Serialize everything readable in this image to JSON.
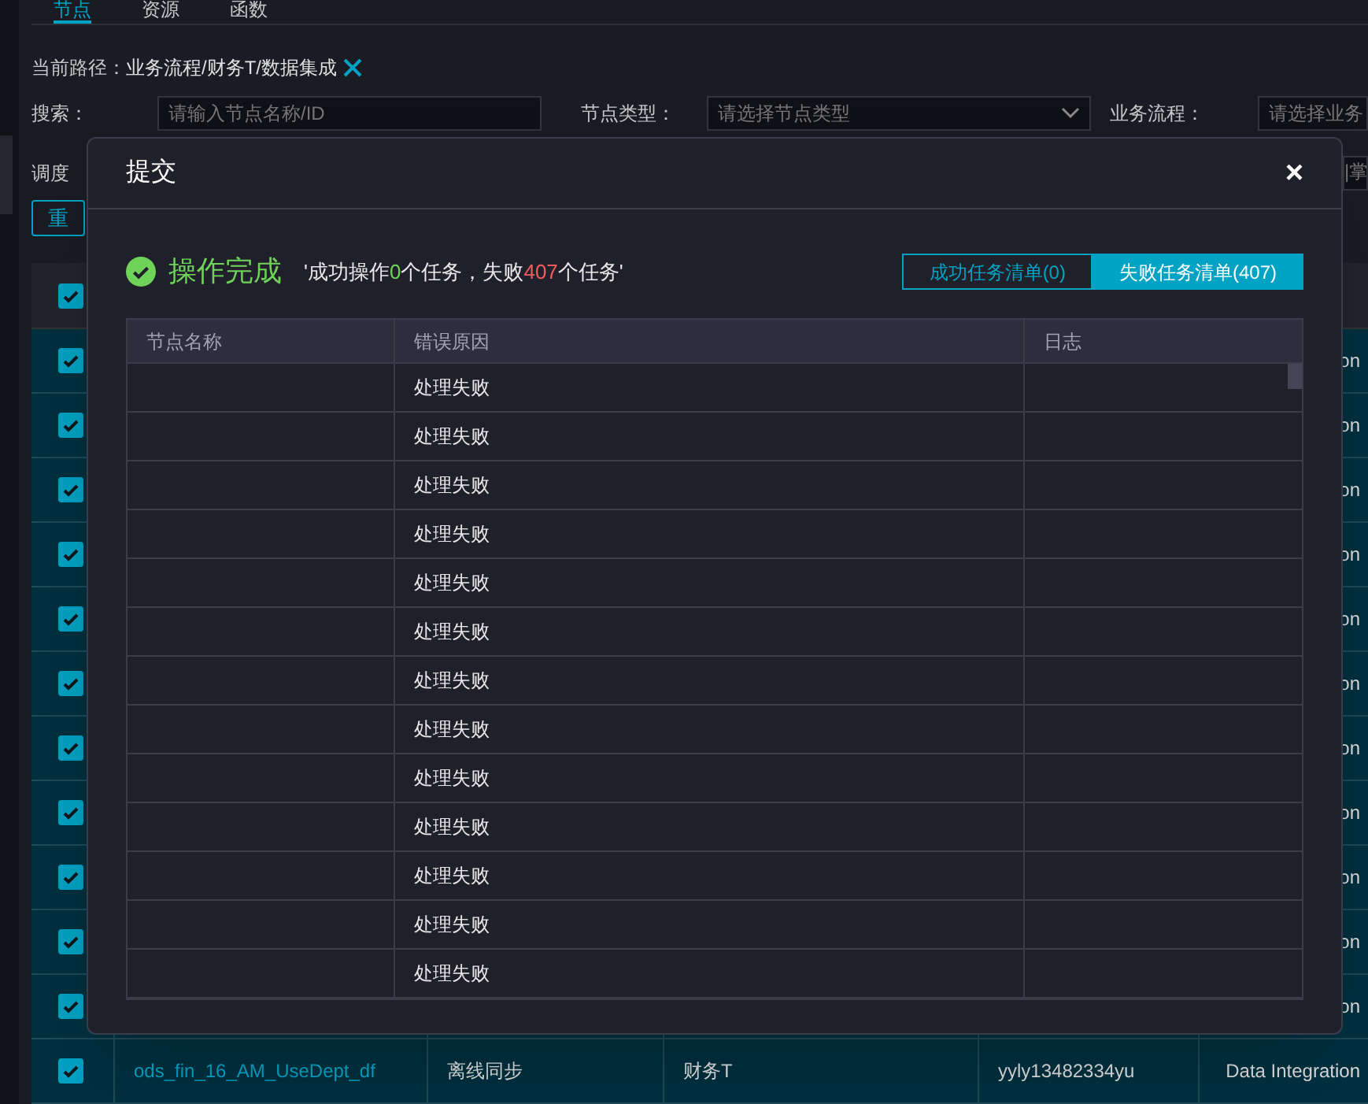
{
  "tabs": [
    {
      "label": "节点",
      "selected": true
    },
    {
      "label": "资源",
      "selected": false
    },
    {
      "label": "函数",
      "selected": false
    }
  ],
  "path": {
    "label": "当前路径：",
    "value": "业务流程/财务T/数据集成"
  },
  "filters": [
    {
      "label": "搜索：",
      "placeholder": "请输入节点名称/ID",
      "kind": "input"
    },
    {
      "label": "节点类型：",
      "placeholder": "请选择节点类型",
      "kind": "select"
    },
    {
      "label": "业务流程：",
      "placeholder": "请选择业务",
      "kind": "input"
    }
  ],
  "filters_row2": {
    "label": "调度",
    "field_text": "|掌"
  },
  "reset_button": "重",
  "table": {
    "header_checked": true,
    "rows": [
      {
        "checked": true,
        "column_6": "on"
      },
      {
        "checked": true,
        "column_6": "on"
      },
      {
        "checked": true,
        "column_6": "on"
      },
      {
        "checked": true,
        "column_6": "on"
      },
      {
        "checked": true,
        "column_6": "on"
      },
      {
        "checked": true,
        "column_6": "on"
      },
      {
        "checked": true,
        "column_6": "on"
      },
      {
        "checked": true,
        "column_6": "on"
      },
      {
        "checked": true,
        "column_6": "on"
      },
      {
        "checked": true,
        "column_6": "on"
      },
      {
        "checked": true,
        "column_6": "on"
      },
      {
        "checked": true,
        "name": "ods_fin_16_AM_UseDept_df",
        "type": "离线同步",
        "flow": "财务T",
        "owner": "yyly13482334yu",
        "column_6": "Data Integration"
      }
    ]
  },
  "dialog": {
    "title": "提交",
    "close": "×",
    "status": "操作完成",
    "message": [
      {
        "text": "'成功操作",
        "color": "#e8e8e8"
      },
      {
        "text": "0",
        "color": "#6fd35a"
      },
      {
        "text": "个任务，失败",
        "color": "#e8e8e8"
      },
      {
        "text": "407",
        "color": "#f35d5d"
      },
      {
        "text": "个任务'",
        "color": "#e8e8e8"
      }
    ],
    "lists": [
      {
        "label": "成功任务清单(0)",
        "selected": false
      },
      {
        "label": "失败任务清单(407)",
        "selected": true
      }
    ],
    "columns": [
      "节点名称",
      "错误原因",
      "日志"
    ],
    "rows": [
      {
        "error_reason": "处理失败"
      },
      {
        "error_reason": "处理失败"
      },
      {
        "error_reason": "处理失败"
      },
      {
        "error_reason": "处理失败"
      },
      {
        "error_reason": "处理失败"
      },
      {
        "error_reason": "处理失败"
      },
      {
        "error_reason": "处理失败"
      },
      {
        "error_reason": "处理失败"
      },
      {
        "error_reason": "处理失败"
      },
      {
        "error_reason": "处理失败"
      },
      {
        "error_reason": "处理失败"
      },
      {
        "error_reason": "处理失败"
      },
      {
        "error_reason": "处理失败"
      }
    ]
  }
}
